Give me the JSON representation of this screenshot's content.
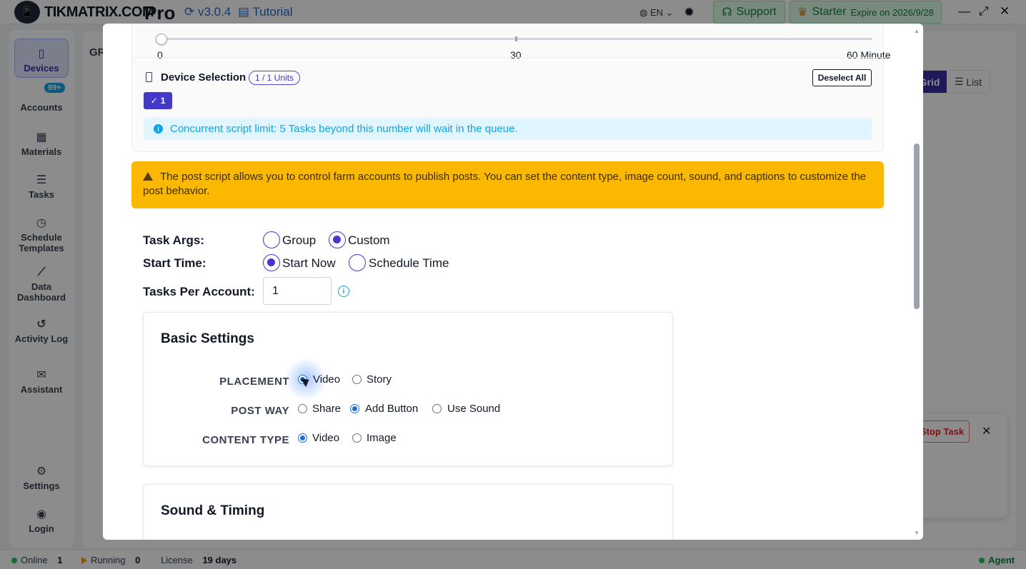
{
  "app": {
    "brand": "TIKMATRIX.COM",
    "edition": "Pro",
    "version": "v3.0.4",
    "tutorial": "Tutorial",
    "language": "EN",
    "support": "Support",
    "plan": "Starter",
    "expire": "Expire on 2026/9/28"
  },
  "sidebar": {
    "items": [
      {
        "label": "Devices",
        "icon": "phone-icon"
      },
      {
        "label": "Accounts",
        "icon": "users-icon",
        "badge": "99+"
      },
      {
        "label": "Materials",
        "icon": "film-icon"
      },
      {
        "label": "Tasks",
        "icon": "list-icon"
      },
      {
        "label": "Schedule Templates",
        "icon": "clock-icon"
      },
      {
        "label": "Data Dashboard",
        "icon": "chart-icon"
      },
      {
        "label": "Activity Log",
        "icon": "history-icon"
      },
      {
        "label": "Assistant",
        "icon": "chat-icon"
      },
      {
        "label": "Settings",
        "icon": "gear-icon"
      },
      {
        "label": "Login",
        "icon": "user-icon"
      }
    ]
  },
  "background": {
    "group_label": "GR",
    "view_grid": "Grid",
    "view_list": "List",
    "stop_task": "Stop Task"
  },
  "statusbar": {
    "online_label": "Online",
    "online_count": "1",
    "running_label": "Running",
    "running_count": "0",
    "license_label": "License",
    "license_value": "19 days",
    "agent": "Agent"
  },
  "modal": {
    "slider": {
      "min_label": "0",
      "mid_label": "30",
      "max_label": "60 Minute",
      "value": 0
    },
    "device_selection": {
      "title": "Device Selection",
      "units": "1 / 1 Units",
      "deselect": "Deselect All",
      "selected_chip": "1"
    },
    "info": "Concurrent script limit: 5 Tasks beyond this number will wait in the queue.",
    "warning": "The post script allows you to control farm accounts to publish posts. You can set the content type, image count, sound, and captions to customize the post behavior.",
    "task_args": {
      "label": "Task Args:",
      "options": [
        "Group",
        "Custom"
      ],
      "selected": "Custom"
    },
    "start_time": {
      "label": "Start Time:",
      "options": [
        "Start Now",
        "Schedule Time"
      ],
      "selected": "Start Now"
    },
    "tasks_per_account": {
      "label": "Tasks Per Account:",
      "value": "1"
    },
    "basic_settings": {
      "title": "Basic Settings",
      "placement": {
        "label": "PLACEMENT",
        "options": [
          "Video",
          "Story"
        ],
        "selected": "Video"
      },
      "post_way": {
        "label": "POST WAY",
        "options": [
          "Share",
          "Add Button",
          "Use Sound"
        ],
        "selected": "Add Button"
      },
      "content_type": {
        "label": "CONTENT TYPE",
        "options": [
          "Video",
          "Image"
        ],
        "selected": "Video"
      }
    },
    "sound_timing": {
      "title": "Sound & Timing"
    }
  },
  "colors": {
    "primary": "#4338ca",
    "info": "#0ea5e9",
    "warning": "#fbb800",
    "success": "#15803d"
  }
}
